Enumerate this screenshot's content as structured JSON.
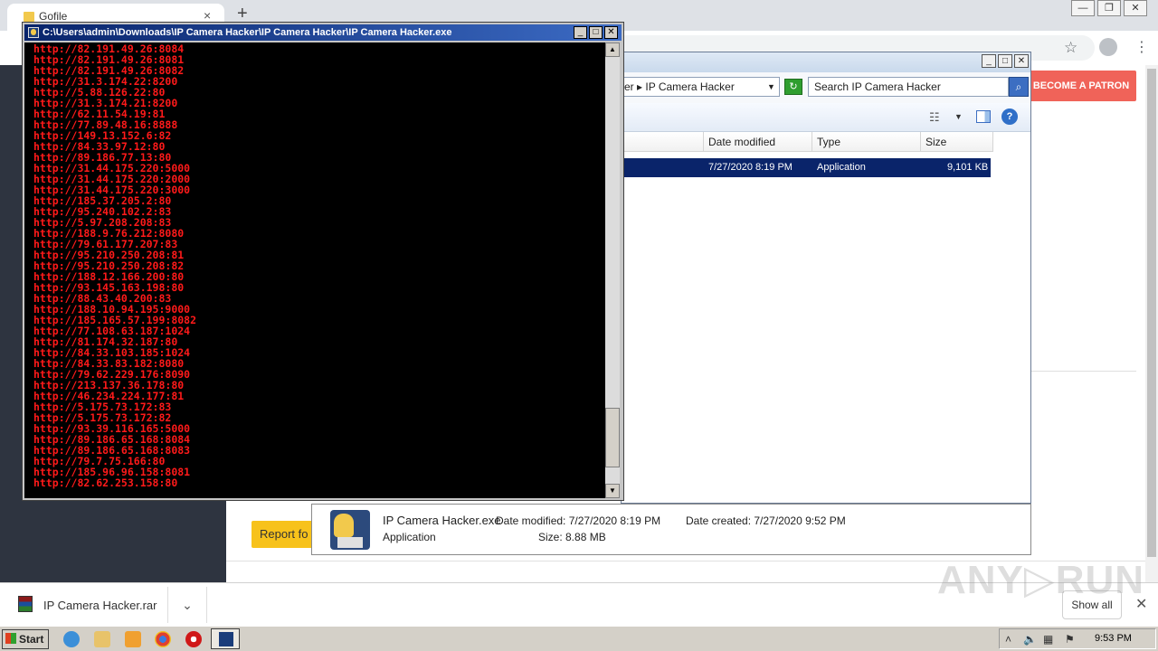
{
  "browser": {
    "tab_title": "Gofile",
    "tab_close": "×",
    "new_tab": "+",
    "window_controls": [
      "—",
      "❐",
      "✕"
    ],
    "star": "☆",
    "menu": "⋮"
  },
  "page": {
    "patron_button": "BECOME A PATRON",
    "report_button": "Report fo"
  },
  "download_bar": {
    "file_name": "IP Camera Hacker.rar",
    "arrow": "⌄",
    "show_all": "Show all",
    "close": "✕"
  },
  "explorer": {
    "controls": [
      "_",
      "□",
      "✕"
    ],
    "address_text": "er  ▸ IP Camera Hacker",
    "address_dropdown": "▼",
    "search_placeholder": "Search IP Camera Hacker",
    "columns": [
      "Date modified",
      "Type",
      "Size"
    ],
    "file_row": {
      "date_modified": "7/27/2020 8:19 PM",
      "type": "Application",
      "size": "9,101 KB"
    },
    "details": {
      "name": "IP Camera Hacker.exe",
      "date_modified": "Date modified:  7/27/2020 8:19 PM",
      "date_created": "Date created:  7/27/2020 9:52 PM",
      "type": "Application",
      "size": "Size:  8.88 MB"
    }
  },
  "console": {
    "title": "C:\\Users\\admin\\Downloads\\IP Camera Hacker\\IP Camera Hacker\\IP Camera Hacker.exe",
    "controls": [
      "_",
      "□",
      "✕"
    ],
    "lines": [
      "http://82.191.49.26:8084",
      "http://82.191.49.26:8081",
      "http://82.191.49.26:8082",
      "http://31.3.174.22:8200",
      "http://5.88.126.22:80",
      "http://31.3.174.21:8200",
      "http://62.11.54.19:81",
      "http://77.89.48.16:8888",
      "http://149.13.152.6:82",
      "http://84.33.97.12:80",
      "http://89.186.77.13:80",
      "http://31.44.175.220:5000",
      "http://31.44.175.220:2000",
      "http://31.44.175.220:3000",
      "http://185.37.205.2:80",
      "http://95.240.102.2:83",
      "http://5.97.208.208:83",
      "http://188.9.76.212:8080",
      "http://79.61.177.207:83",
      "http://95.210.250.208:81",
      "http://95.210.250.208:82",
      "http://188.12.166.200:80",
      "http://93.145.163.198:80",
      "http://88.43.40.200:83",
      "http://188.10.94.195:9000",
      "http://185.165.57.199:8082",
      "http://77.108.63.187:1024",
      "http://81.174.32.187:80",
      "http://84.33.103.185:1024",
      "http://84.33.83.182:8080",
      "http://79.62.229.176:8090",
      "http://213.137.36.178:80",
      "http://46.234.224.177:81",
      "http://5.175.73.172:83",
      "http://5.175.73.172:82",
      "http://93.39.116.165:5000",
      "http://89.186.65.168:8084",
      "http://89.186.65.168:8083",
      "http://79.7.75.166:80",
      "http://185.96.96.158:8081",
      "http://82.62.253.158:80"
    ]
  },
  "watermark": "ANY▷RUN",
  "taskbar": {
    "start": "Start",
    "clock": "9:53 PM"
  }
}
